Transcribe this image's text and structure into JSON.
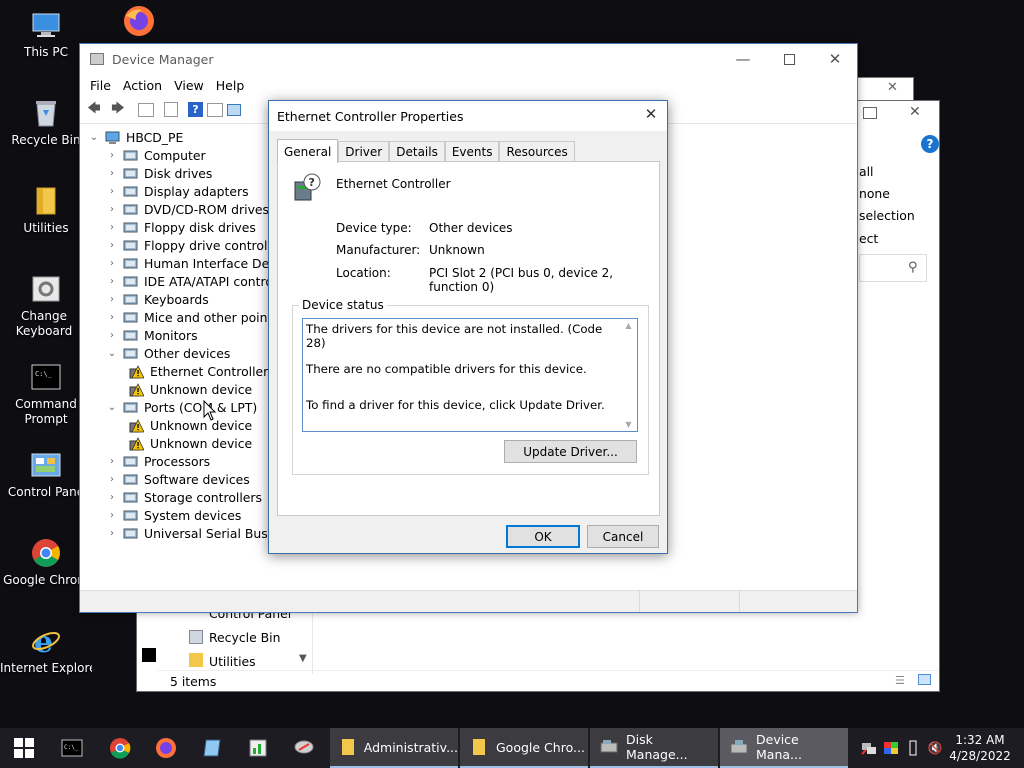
{
  "desktop": {
    "icons": [
      {
        "label": "This PC"
      },
      {
        "label": "Recycle Bin"
      },
      {
        "label": "Utilities"
      },
      {
        "label": "Change Keyboard Layo"
      },
      {
        "label": "Command Prompt"
      },
      {
        "label": "Control Pane"
      },
      {
        "label": "Google Chrom"
      },
      {
        "label": "Internet Explorer"
      }
    ]
  },
  "explorer": {
    "ribbon_items": [
      "all",
      "none",
      "selection",
      "ect"
    ],
    "nav_items": [
      "Control Panel",
      "Recycle Bin",
      "Utilities"
    ],
    "status": "5 items"
  },
  "device_manager": {
    "title": "Device Manager",
    "menu": [
      "File",
      "Action",
      "View",
      "Help"
    ],
    "tree_root": "HBCD_PE",
    "tree": [
      {
        "label": "Computer",
        "expanded": false
      },
      {
        "label": "Disk drives",
        "expanded": false
      },
      {
        "label": "Display adapters",
        "expanded": false
      },
      {
        "label": "DVD/CD-ROM drives",
        "expanded": false
      },
      {
        "label": "Floppy disk drives",
        "expanded": false
      },
      {
        "label": "Floppy drive controllers",
        "expanded": false
      },
      {
        "label": "Human Interface Device",
        "expanded": false
      },
      {
        "label": "IDE ATA/ATAPI controlle",
        "expanded": false
      },
      {
        "label": "Keyboards",
        "expanded": false
      },
      {
        "label": "Mice and other pointing",
        "expanded": false
      },
      {
        "label": "Monitors",
        "expanded": false
      },
      {
        "label": "Other devices",
        "expanded": true
      },
      {
        "label": "Ethernet Controller",
        "child": true
      },
      {
        "label": "Unknown device",
        "child": true
      },
      {
        "label": "Ports (COM & LPT)",
        "expanded": true
      },
      {
        "label": "Unknown device",
        "child": true
      },
      {
        "label": "Unknown device",
        "child": true
      },
      {
        "label": "Processors",
        "expanded": false
      },
      {
        "label": "Software devices",
        "expanded": false
      },
      {
        "label": "Storage controllers",
        "expanded": false
      },
      {
        "label": "System devices",
        "expanded": false
      },
      {
        "label": "Universal Serial Bus con",
        "expanded": false
      }
    ]
  },
  "dialog": {
    "title": "Ethernet Controller Properties",
    "tabs": [
      "General",
      "Driver",
      "Details",
      "Events",
      "Resources"
    ],
    "active_tab": "General",
    "device_name": "Ethernet Controller",
    "device_type_label": "Device type:",
    "device_type": "Other devices",
    "manufacturer_label": "Manufacturer:",
    "manufacturer": "Unknown",
    "location_label": "Location:",
    "location": "PCI Slot 2 (PCI bus 0, device 2, function 0)",
    "status_group": "Device status",
    "status_lines": [
      "The drivers for this device are not installed. (Code 28)",
      "There are no compatible drivers for this device.",
      "To find a driver for this device, click Update Driver."
    ],
    "update_button": "Update Driver...",
    "ok": "OK",
    "cancel": "Cancel"
  },
  "taskbar": {
    "apps": [
      {
        "label": "Administrativ..."
      },
      {
        "label": "Google Chro..."
      },
      {
        "label": "Disk Manage..."
      },
      {
        "label": "Device Mana...",
        "active": true
      }
    ],
    "time": "1:32 AM",
    "date": "4/28/2022"
  },
  "colors": {
    "accent": "#0078d7",
    "taskbar": "#1c1c22",
    "desktop": "#0d0d12"
  }
}
